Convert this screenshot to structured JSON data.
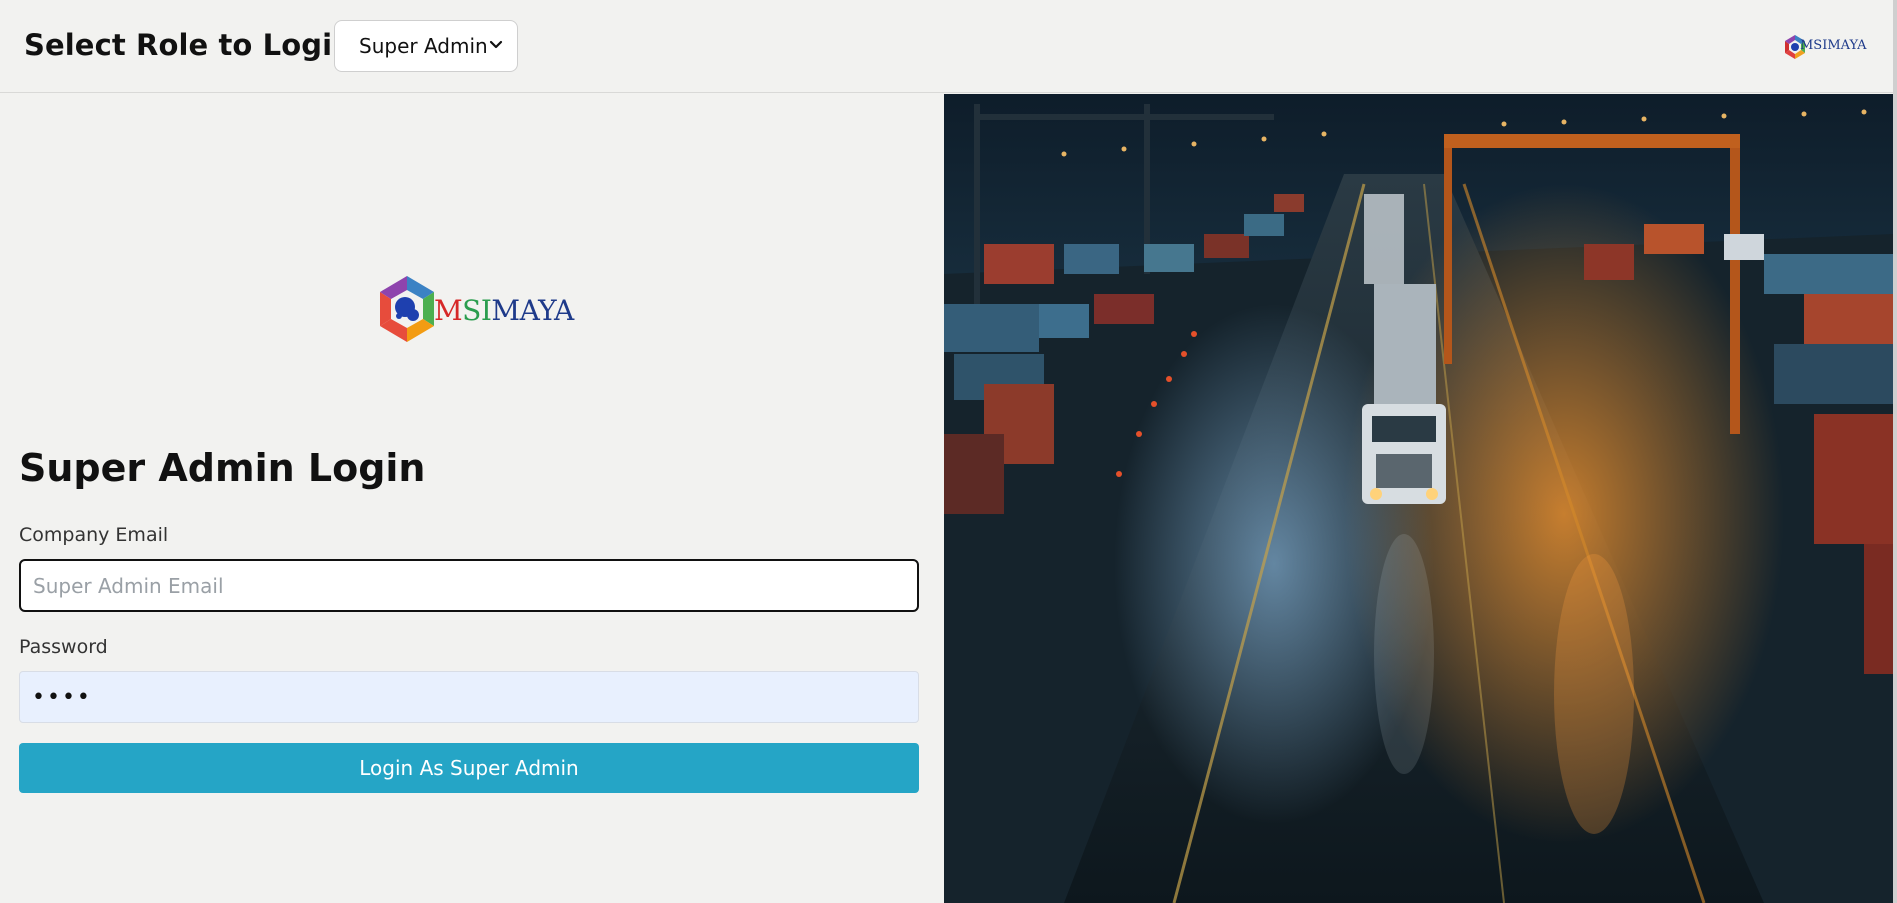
{
  "header": {
    "title": "Select Role to Login",
    "role_select": {
      "selected": "Super Admin"
    },
    "logo_text": "MSIMAYA"
  },
  "login": {
    "logo_text": "MSIMAYA",
    "heading": "Super Admin Login",
    "email": {
      "label": "Company Email",
      "placeholder": "Super Admin Email",
      "value": ""
    },
    "password": {
      "label": "Password",
      "value": "••••"
    },
    "submit_label": "Login As Super Admin"
  },
  "theme": {
    "accent": "#25a5c6",
    "background": "#f2f2f0",
    "autofill": "#e8f0fe"
  },
  "hero_image": {
    "subject": "night-container-port-truck-photo"
  }
}
